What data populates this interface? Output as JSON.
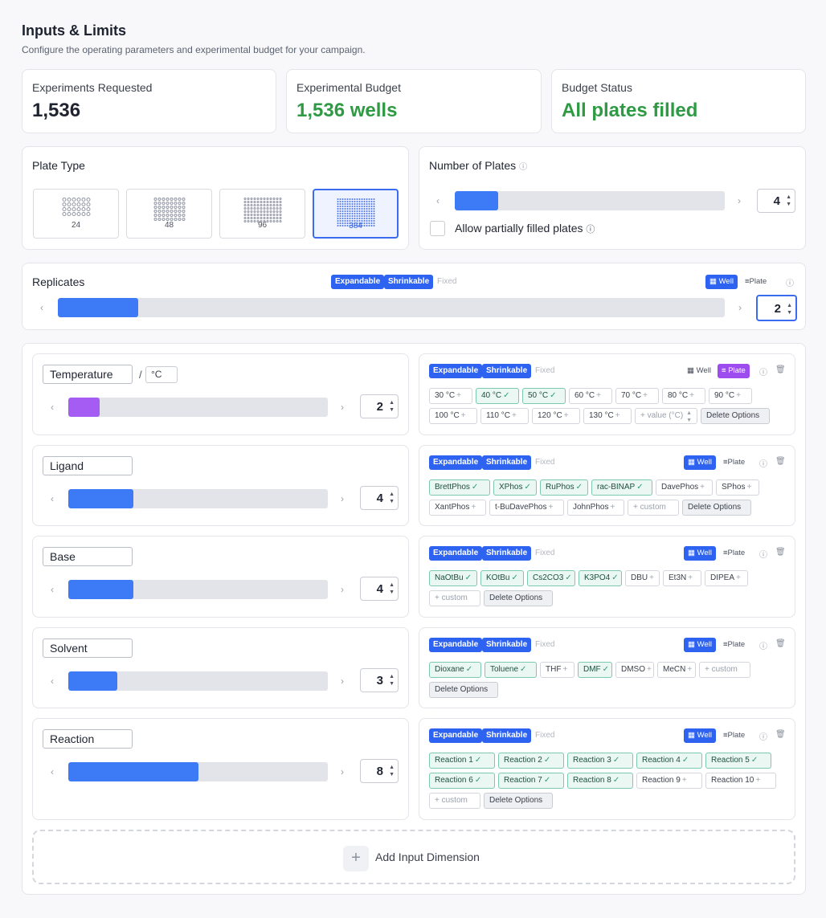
{
  "header": {
    "title": "Inputs & Limits",
    "subtitle": "Configure the operating parameters and experimental budget for your campaign."
  },
  "stats": [
    {
      "label": "Experiments Requested",
      "value": "1,536",
      "color": "#1f2430"
    },
    {
      "label": "Experimental Budget",
      "value": "1,536 wells",
      "color": "#2f9a44"
    },
    {
      "label": "Budget Status",
      "value": "All plates filled",
      "color": "#2f9a44"
    }
  ],
  "plate_type": {
    "title": "Plate Type",
    "options": [
      {
        "label": "24",
        "cols": 6,
        "rows": 4,
        "selected": false
      },
      {
        "label": "48",
        "cols": 8,
        "rows": 6,
        "selected": false
      },
      {
        "label": "96",
        "cols": 12,
        "rows": 8,
        "selected": false
      },
      {
        "label": "384",
        "cols": 16,
        "rows": 12,
        "selected": true
      }
    ]
  },
  "num_plates": {
    "title": "Number of Plates",
    "value": "4",
    "fill": 0.16,
    "partial_label": "Allow partially filled plates"
  },
  "common": {
    "expandable": "Expandable",
    "shrinkable": "Shrinkable",
    "fixed": "Fixed",
    "well": "Well",
    "plate": "Plate",
    "delete_options": "Delete Options"
  },
  "replicates": {
    "title": "Replicates",
    "value": "2",
    "fill": 0.12
  },
  "dimensions": [
    {
      "name": "Temperature",
      "unit": "°C",
      "value": "2",
      "fill": 0.12,
      "purple": true,
      "mode": "plate",
      "options": [
        [
          "30 °C",
          false
        ],
        [
          "40 °C",
          true
        ],
        [
          "50 °C",
          true
        ],
        [
          "60 °C",
          false
        ],
        [
          "70 °C",
          false
        ],
        [
          "80 °C",
          false
        ],
        [
          "90 °C",
          false
        ],
        [
          "100 °C",
          false
        ],
        [
          "110 °C",
          false
        ],
        [
          "120 °C",
          false
        ],
        [
          "130 °C",
          false
        ]
      ],
      "placeholder": "+ value (°C)"
    },
    {
      "name": "Ligand",
      "value": "4",
      "fill": 0.25,
      "mode": "well",
      "options": [
        [
          "BrettPhos",
          true
        ],
        [
          "XPhos",
          true
        ],
        [
          "RuPhos",
          true
        ],
        [
          "rac-BINAP",
          true
        ],
        [
          "DavePhos",
          false
        ],
        [
          "SPhos",
          false
        ],
        [
          "XantPhos",
          false
        ],
        [
          "t-BuDavePhos",
          false
        ],
        [
          "JohnPhos",
          false
        ]
      ],
      "placeholder": "+ custom"
    },
    {
      "name": "Base",
      "value": "4",
      "fill": 0.25,
      "mode": "well",
      "options": [
        [
          "NaOtBu",
          true
        ],
        [
          "KOtBu",
          true
        ],
        [
          "Cs2CO3",
          true
        ],
        [
          "K3PO4",
          true
        ],
        [
          "DBU",
          false
        ],
        [
          "Et3N",
          false
        ],
        [
          "DIPEA",
          false
        ]
      ],
      "placeholder": "+ custom"
    },
    {
      "name": "Solvent",
      "value": "3",
      "fill": 0.19,
      "mode": "well",
      "options": [
        [
          "Dioxane",
          true
        ],
        [
          "Toluene",
          true
        ],
        [
          "THF",
          false
        ],
        [
          "DMF",
          true
        ],
        [
          "DMSO",
          false
        ],
        [
          "MeCN",
          false
        ]
      ],
      "placeholder": "+ custom"
    },
    {
      "name": "Reaction",
      "value": "8",
      "fill": 0.5,
      "mode": "well",
      "options": [
        [
          "Reaction 1",
          true
        ],
        [
          "Reaction 2",
          true
        ],
        [
          "Reaction 3",
          true
        ],
        [
          "Reaction 4",
          true
        ],
        [
          "Reaction 5",
          true
        ],
        [
          "Reaction 6",
          true
        ],
        [
          "Reaction 7",
          true
        ],
        [
          "Reaction 8",
          true
        ],
        [
          "Reaction 9",
          false
        ],
        [
          "Reaction 10",
          false
        ]
      ],
      "placeholder": "+ custom"
    }
  ],
  "add_dimension": "Add Input Dimension"
}
